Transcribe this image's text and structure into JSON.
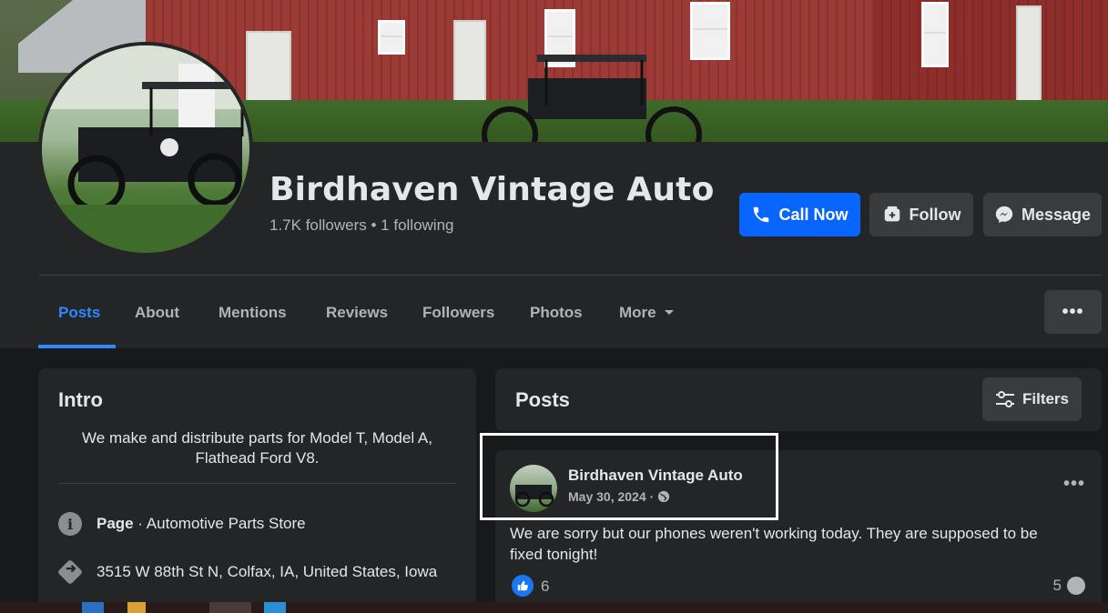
{
  "page": {
    "name": "Birdhaven Vintage Auto",
    "stats": "1.7K followers • 1 following"
  },
  "actions": {
    "call_now": "Call Now",
    "follow": "Follow",
    "message": "Message",
    "more_dots": "•••"
  },
  "tabs": [
    {
      "label": "Posts",
      "active": true
    },
    {
      "label": "About"
    },
    {
      "label": "Mentions"
    },
    {
      "label": "Reviews"
    },
    {
      "label": "Followers"
    },
    {
      "label": "Photos"
    },
    {
      "label": "More"
    }
  ],
  "intro": {
    "title": "Intro",
    "bio": "We make and distribute parts for Model T, Model A, Flathead Ford V8.",
    "page_type_bold": "Page",
    "page_type_rest": " · Automotive Parts Store",
    "address": "3515 W 88th St N, Colfax, IA, United States, Iowa"
  },
  "posts": {
    "title": "Posts",
    "filters_label": "Filters",
    "items": [
      {
        "author": "Birdhaven Vintage Auto",
        "date": "May 30, 2024",
        "separator": "·",
        "text": "We are sorry but our phones weren't working today. They are supposed to be fixed tonight!",
        "likes": "6",
        "comments": "5"
      }
    ]
  },
  "colors": {
    "accent": "#2d88ff",
    "primary_button": "#0866ff",
    "background": "#18191a",
    "card": "#242526"
  },
  "icons": {
    "call": "phone-icon",
    "follow": "follow-icon",
    "message": "messenger-icon",
    "more_caret": "caret-down-icon",
    "filters": "filters-icon",
    "info": "info-icon",
    "directions": "directions-icon",
    "globe": "globe-icon",
    "like": "like-icon",
    "comment": "comment-icon"
  }
}
